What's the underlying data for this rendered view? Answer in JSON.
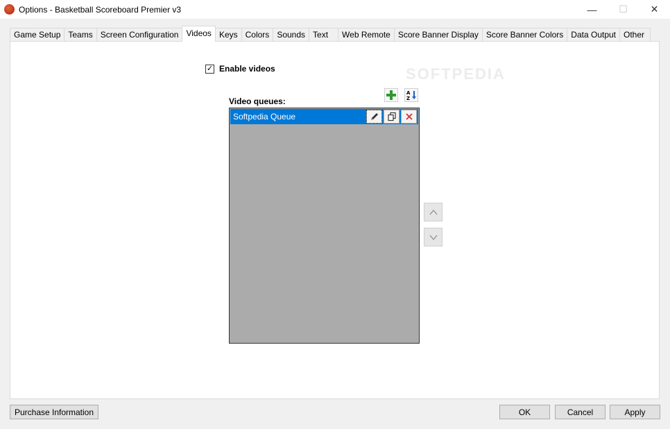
{
  "window": {
    "title": "Options - Basketball Scoreboard Premier v3",
    "minimize_glyph": "—",
    "maximize_glyph": "☐",
    "close_glyph": "✕"
  },
  "tabs": [
    {
      "label": "Game Setup"
    },
    {
      "label": "Teams"
    },
    {
      "label": "Screen Configuration"
    },
    {
      "label": "Videos",
      "active": true
    },
    {
      "label": "Keys"
    },
    {
      "label": "Colors"
    },
    {
      "label": "Sounds"
    },
    {
      "label": "Text"
    },
    {
      "label": "Web Remote"
    },
    {
      "label": "Score Banner Display"
    },
    {
      "label": "Score Banner Colors"
    },
    {
      "label": "Data Output"
    },
    {
      "label": "Other"
    }
  ],
  "videos": {
    "enable_label": "Enable videos",
    "enable_checked": true,
    "check_glyph": "✓",
    "queues_label": "Video queues:",
    "add_icon": "plus-icon",
    "sort_icon": "sort-az-icon",
    "queues": [
      {
        "name": "Softpedia Queue",
        "selected": true
      }
    ],
    "item_actions": [
      "edit-icon",
      "copy-icon",
      "delete-icon"
    ],
    "move_up_glyph": "^",
    "move_down_glyph": "v"
  },
  "watermark": "SOFTPEDIA",
  "buttons": {
    "purchase": "Purchase Information",
    "ok": "OK",
    "cancel": "Cancel",
    "apply": "Apply"
  },
  "colors": {
    "selection": "#0078d7",
    "listbox_bg": "#ababab",
    "add_green": "#2e9a2e",
    "delete_red": "#d03030"
  }
}
